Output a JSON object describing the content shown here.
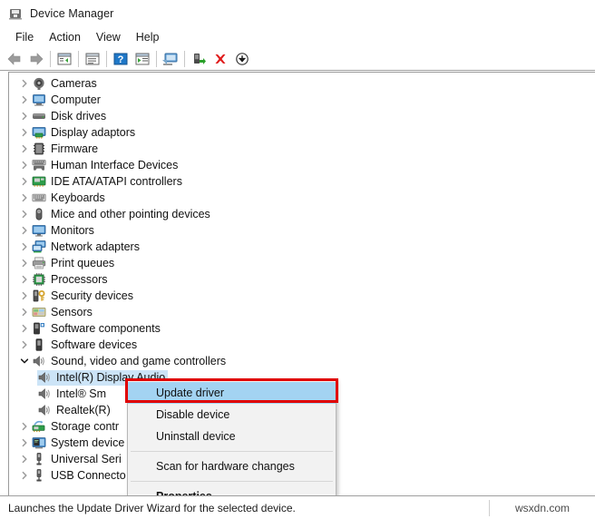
{
  "window": {
    "title": "Device Manager",
    "icon": "device-manager-icon"
  },
  "menubar": {
    "items": [
      {
        "label": "File"
      },
      {
        "label": "Action"
      },
      {
        "label": "View"
      },
      {
        "label": "Help"
      }
    ]
  },
  "toolbar": {
    "buttons": [
      {
        "icon": "back-arrow-icon",
        "title": "Back"
      },
      {
        "icon": "forward-arrow-icon",
        "title": "Forward"
      },
      {
        "sep": true
      },
      {
        "icon": "show-hide-console-tree-icon",
        "title": "Show/Hide Console Tree"
      },
      {
        "sep": true
      },
      {
        "icon": "properties-icon",
        "title": "Properties"
      },
      {
        "sep": true
      },
      {
        "icon": "help-icon",
        "title": "Help"
      },
      {
        "icon": "update-driver-toolbar-icon",
        "title": "Update Driver Software"
      },
      {
        "sep": true
      },
      {
        "icon": "scan-hardware-changes-icon",
        "title": "Scan for hardware changes"
      },
      {
        "sep": true
      },
      {
        "icon": "enable-device-icon",
        "title": "Enable device"
      },
      {
        "icon": "uninstall-device-icon",
        "title": "Uninstall device"
      },
      {
        "icon": "disable-device-icon",
        "title": "Disable device"
      }
    ]
  },
  "tree": {
    "nodes": [
      {
        "label": "Cameras",
        "icon": "camera-icon",
        "expanded": false,
        "depth": 1
      },
      {
        "label": "Computer",
        "icon": "computer-icon",
        "expanded": false,
        "depth": 1
      },
      {
        "label": "Disk drives",
        "icon": "disk-drive-icon",
        "expanded": false,
        "depth": 1
      },
      {
        "label": "Display adaptors",
        "icon": "display-adapter-icon",
        "expanded": false,
        "depth": 1
      },
      {
        "label": "Firmware",
        "icon": "firmware-icon",
        "expanded": false,
        "depth": 1
      },
      {
        "label": "Human Interface Devices",
        "icon": "hid-icon",
        "expanded": false,
        "depth": 1
      },
      {
        "label": "IDE ATA/ATAPI controllers",
        "icon": "ide-controller-icon",
        "expanded": false,
        "depth": 1
      },
      {
        "label": "Keyboards",
        "icon": "keyboard-icon",
        "expanded": false,
        "depth": 1
      },
      {
        "label": "Mice and other pointing devices",
        "icon": "mouse-icon",
        "expanded": false,
        "depth": 1
      },
      {
        "label": "Monitors",
        "icon": "monitor-icon",
        "expanded": false,
        "depth": 1
      },
      {
        "label": "Network adapters",
        "icon": "network-adapter-icon",
        "expanded": false,
        "depth": 1
      },
      {
        "label": "Print queues",
        "icon": "printer-icon",
        "expanded": false,
        "depth": 1
      },
      {
        "label": "Processors",
        "icon": "processor-icon",
        "expanded": false,
        "depth": 1
      },
      {
        "label": "Security devices",
        "icon": "security-device-icon",
        "expanded": false,
        "depth": 1
      },
      {
        "label": "Sensors",
        "icon": "sensor-icon",
        "expanded": false,
        "depth": 1
      },
      {
        "label": "Software components",
        "icon": "software-component-icon",
        "expanded": false,
        "depth": 1
      },
      {
        "label": "Software devices",
        "icon": "software-device-icon",
        "expanded": false,
        "depth": 1
      },
      {
        "label": "Sound, video and game controllers",
        "icon": "speaker-icon",
        "expanded": true,
        "depth": 1
      },
      {
        "label": "Intel(R) Display Audio",
        "icon": "speaker-icon",
        "depth": 2,
        "selected": true
      },
      {
        "label": "Intel® Sm",
        "icon": "speaker-icon",
        "depth": 2,
        "truncated": true
      },
      {
        "label": "Realtek(R)",
        "icon": "speaker-icon",
        "depth": 2,
        "truncated": true
      },
      {
        "label": "Storage contr",
        "icon": "storage-controller-icon",
        "expanded": false,
        "depth": 1,
        "truncated": true
      },
      {
        "label": "System device",
        "icon": "system-device-icon",
        "expanded": false,
        "depth": 1,
        "truncated": true
      },
      {
        "label": "Universal Seri",
        "icon": "usb-icon",
        "expanded": false,
        "depth": 1,
        "truncated": true
      },
      {
        "label": "USB Connecto",
        "icon": "usb-icon",
        "expanded": false,
        "depth": 1,
        "truncated": true
      }
    ]
  },
  "context_menu": {
    "items": [
      {
        "label": "Update driver",
        "highlighted": true,
        "bold": false
      },
      {
        "label": "Disable device",
        "highlighted": false,
        "bold": false
      },
      {
        "label": "Uninstall device",
        "highlighted": false,
        "bold": false
      },
      {
        "separator": true
      },
      {
        "label": "Scan for hardware changes",
        "highlighted": false,
        "bold": false
      },
      {
        "separator": true
      },
      {
        "label": "Properties",
        "highlighted": false,
        "bold": true
      }
    ]
  },
  "annotation": {
    "highlight_border_color": "#e00000",
    "highlight_fill_color": "#a3d3f2",
    "target": "Update driver"
  },
  "statusbar": {
    "text": "Launches the Update Driver Wizard for the selected device.",
    "watermark": "wsxdn.com"
  }
}
